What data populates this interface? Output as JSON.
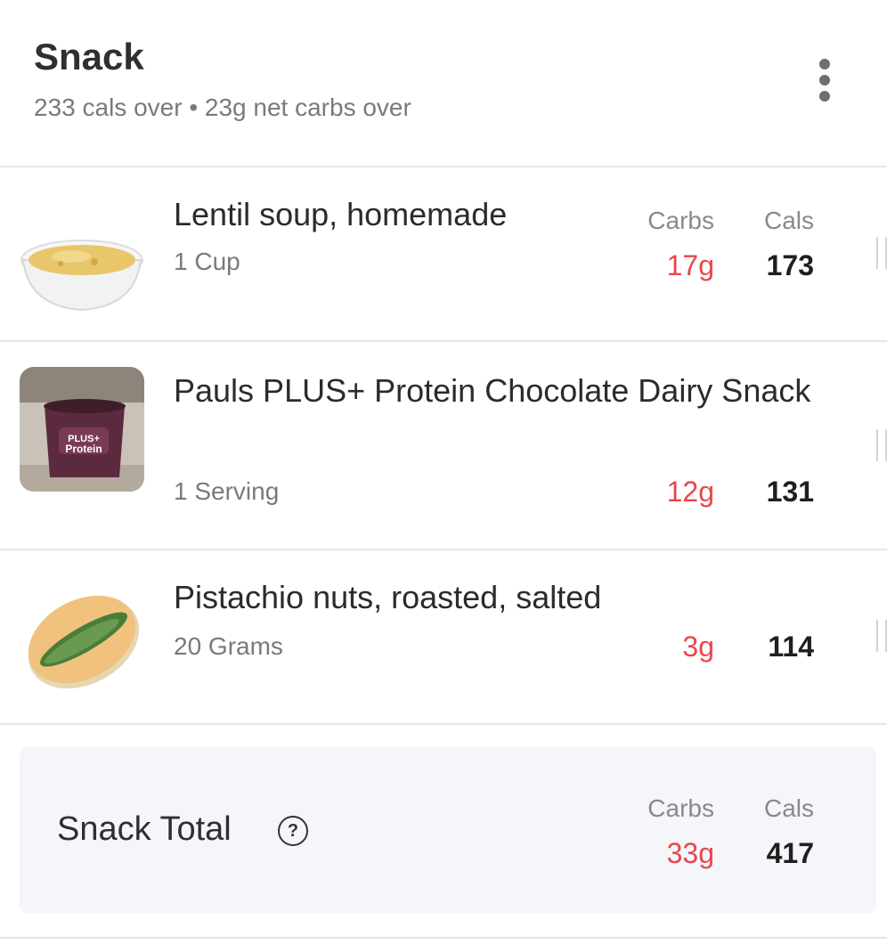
{
  "meal": {
    "title": "Snack",
    "summary": "233 cals over • 23g net carbs over",
    "menu_icon": "more-vertical-icon"
  },
  "columns": {
    "carbs": "Carbs",
    "cals": "Cals"
  },
  "items": [
    {
      "name": "Lentil soup, homemade",
      "quantity": "1 Cup",
      "carbs": "17g",
      "cals": "173",
      "image": "soup-bowl-icon"
    },
    {
      "name": "Pauls PLUS+ Protein Chocolate Dairy Snack",
      "quantity": "1 Serving",
      "carbs": "12g",
      "cals": "131",
      "image": "protein-cup-photo"
    },
    {
      "name": "Pistachio nuts, roasted, salted",
      "quantity": "20 Grams",
      "carbs": "3g",
      "cals": "114",
      "image": "pistachio-icon"
    }
  ],
  "total": {
    "label": "Snack Total",
    "help_icon": "?",
    "carbs_label": "Carbs",
    "cals_label": "Cals",
    "carbs": "33g",
    "cals": "417"
  },
  "colors": {
    "over": "#e8474c",
    "total_bg": "#f4f6fa"
  }
}
